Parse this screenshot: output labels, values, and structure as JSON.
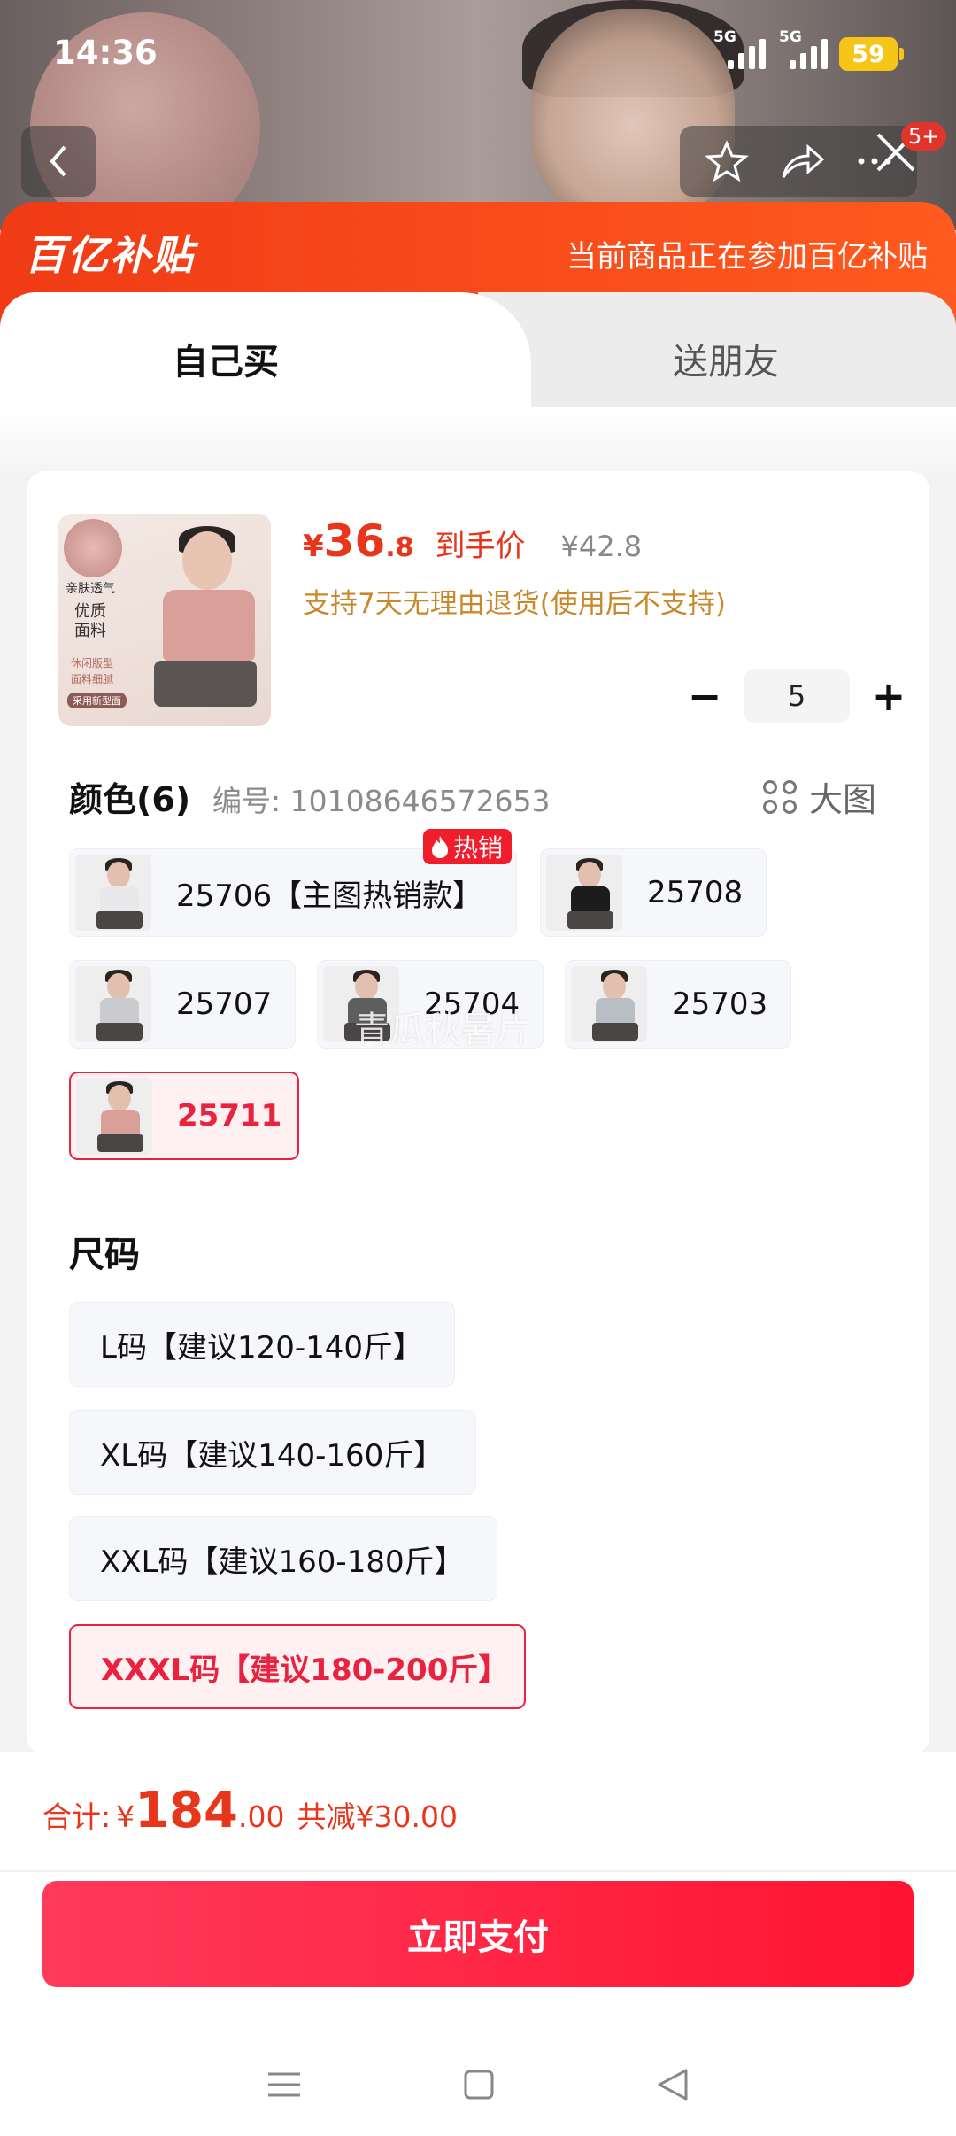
{
  "status_bar": {
    "time": "14:36",
    "network1": "5G",
    "network2": "5G",
    "battery": "59"
  },
  "header": {
    "notification_badge": "5+"
  },
  "banner": {
    "logo": "百亿补贴",
    "note": "当前商品正在参加百亿补贴"
  },
  "tabs": [
    {
      "label": "自己买",
      "active": true
    },
    {
      "label": "送朋友",
      "active": false
    }
  ],
  "product": {
    "thumb_text": {
      "line1": "亲肤透气",
      "line2": "优质",
      "line3": "面料",
      "line4": "休闲版型",
      "line5": "面料细腻",
      "line6": "采用新型面"
    },
    "price_yen": "¥",
    "price_int": "36",
    "price_dec": ".8",
    "price_label": "到手价",
    "original_price": "¥42.8",
    "return_note": "支持7天无理由退货(使用后不支持)"
  },
  "quantity": {
    "minus": "−",
    "value": "5",
    "plus": "+"
  },
  "color_section": {
    "title": "颜色(6)",
    "sku": "编号: 10108646572653",
    "big_pic_label": "大图",
    "hot_tag": "热销",
    "options": [
      {
        "label": "25706【主图热销款】",
        "shirt_color": "#e8e8ea",
        "selected": false
      },
      {
        "label": "25708",
        "shirt_color": "#1c1c1c",
        "selected": false
      },
      {
        "label": "25707",
        "shirt_color": "#c9cbce",
        "selected": false
      },
      {
        "label": "25704",
        "shirt_color": "#5d5f5f",
        "selected": false
      },
      {
        "label": "25703",
        "shirt_color": "#b9bec5",
        "selected": false
      },
      {
        "label": "25711",
        "shirt_color": "#d99f99",
        "selected": true
      }
    ]
  },
  "watermark": "青瓜秋暑片",
  "size_section": {
    "title": "尺码",
    "options": [
      {
        "label": "L码【建议120-140斤】",
        "selected": false
      },
      {
        "label": "XL码【建议140-160斤】",
        "selected": false
      },
      {
        "label": "XXL码【建议160-180斤】",
        "selected": false
      },
      {
        "label": "XXXL码【建议180-200斤】",
        "selected": true
      }
    ]
  },
  "footer": {
    "total_label": "合计:",
    "total_yen": "¥",
    "total_int": "184",
    "total_dec": ".00",
    "total_save": "共减¥30.00",
    "pay_button": "立即支付"
  },
  "colors": {
    "accent": "#e9223f",
    "price": "#e8361c",
    "banner": "#f03b16",
    "note": "#c9892b"
  },
  "icons": [
    "back-icon",
    "star-icon",
    "share-icon",
    "more-icon",
    "close-icon",
    "fire-icon",
    "grid-icon",
    "menu-icon",
    "home-icon",
    "back-triangle-icon"
  ]
}
